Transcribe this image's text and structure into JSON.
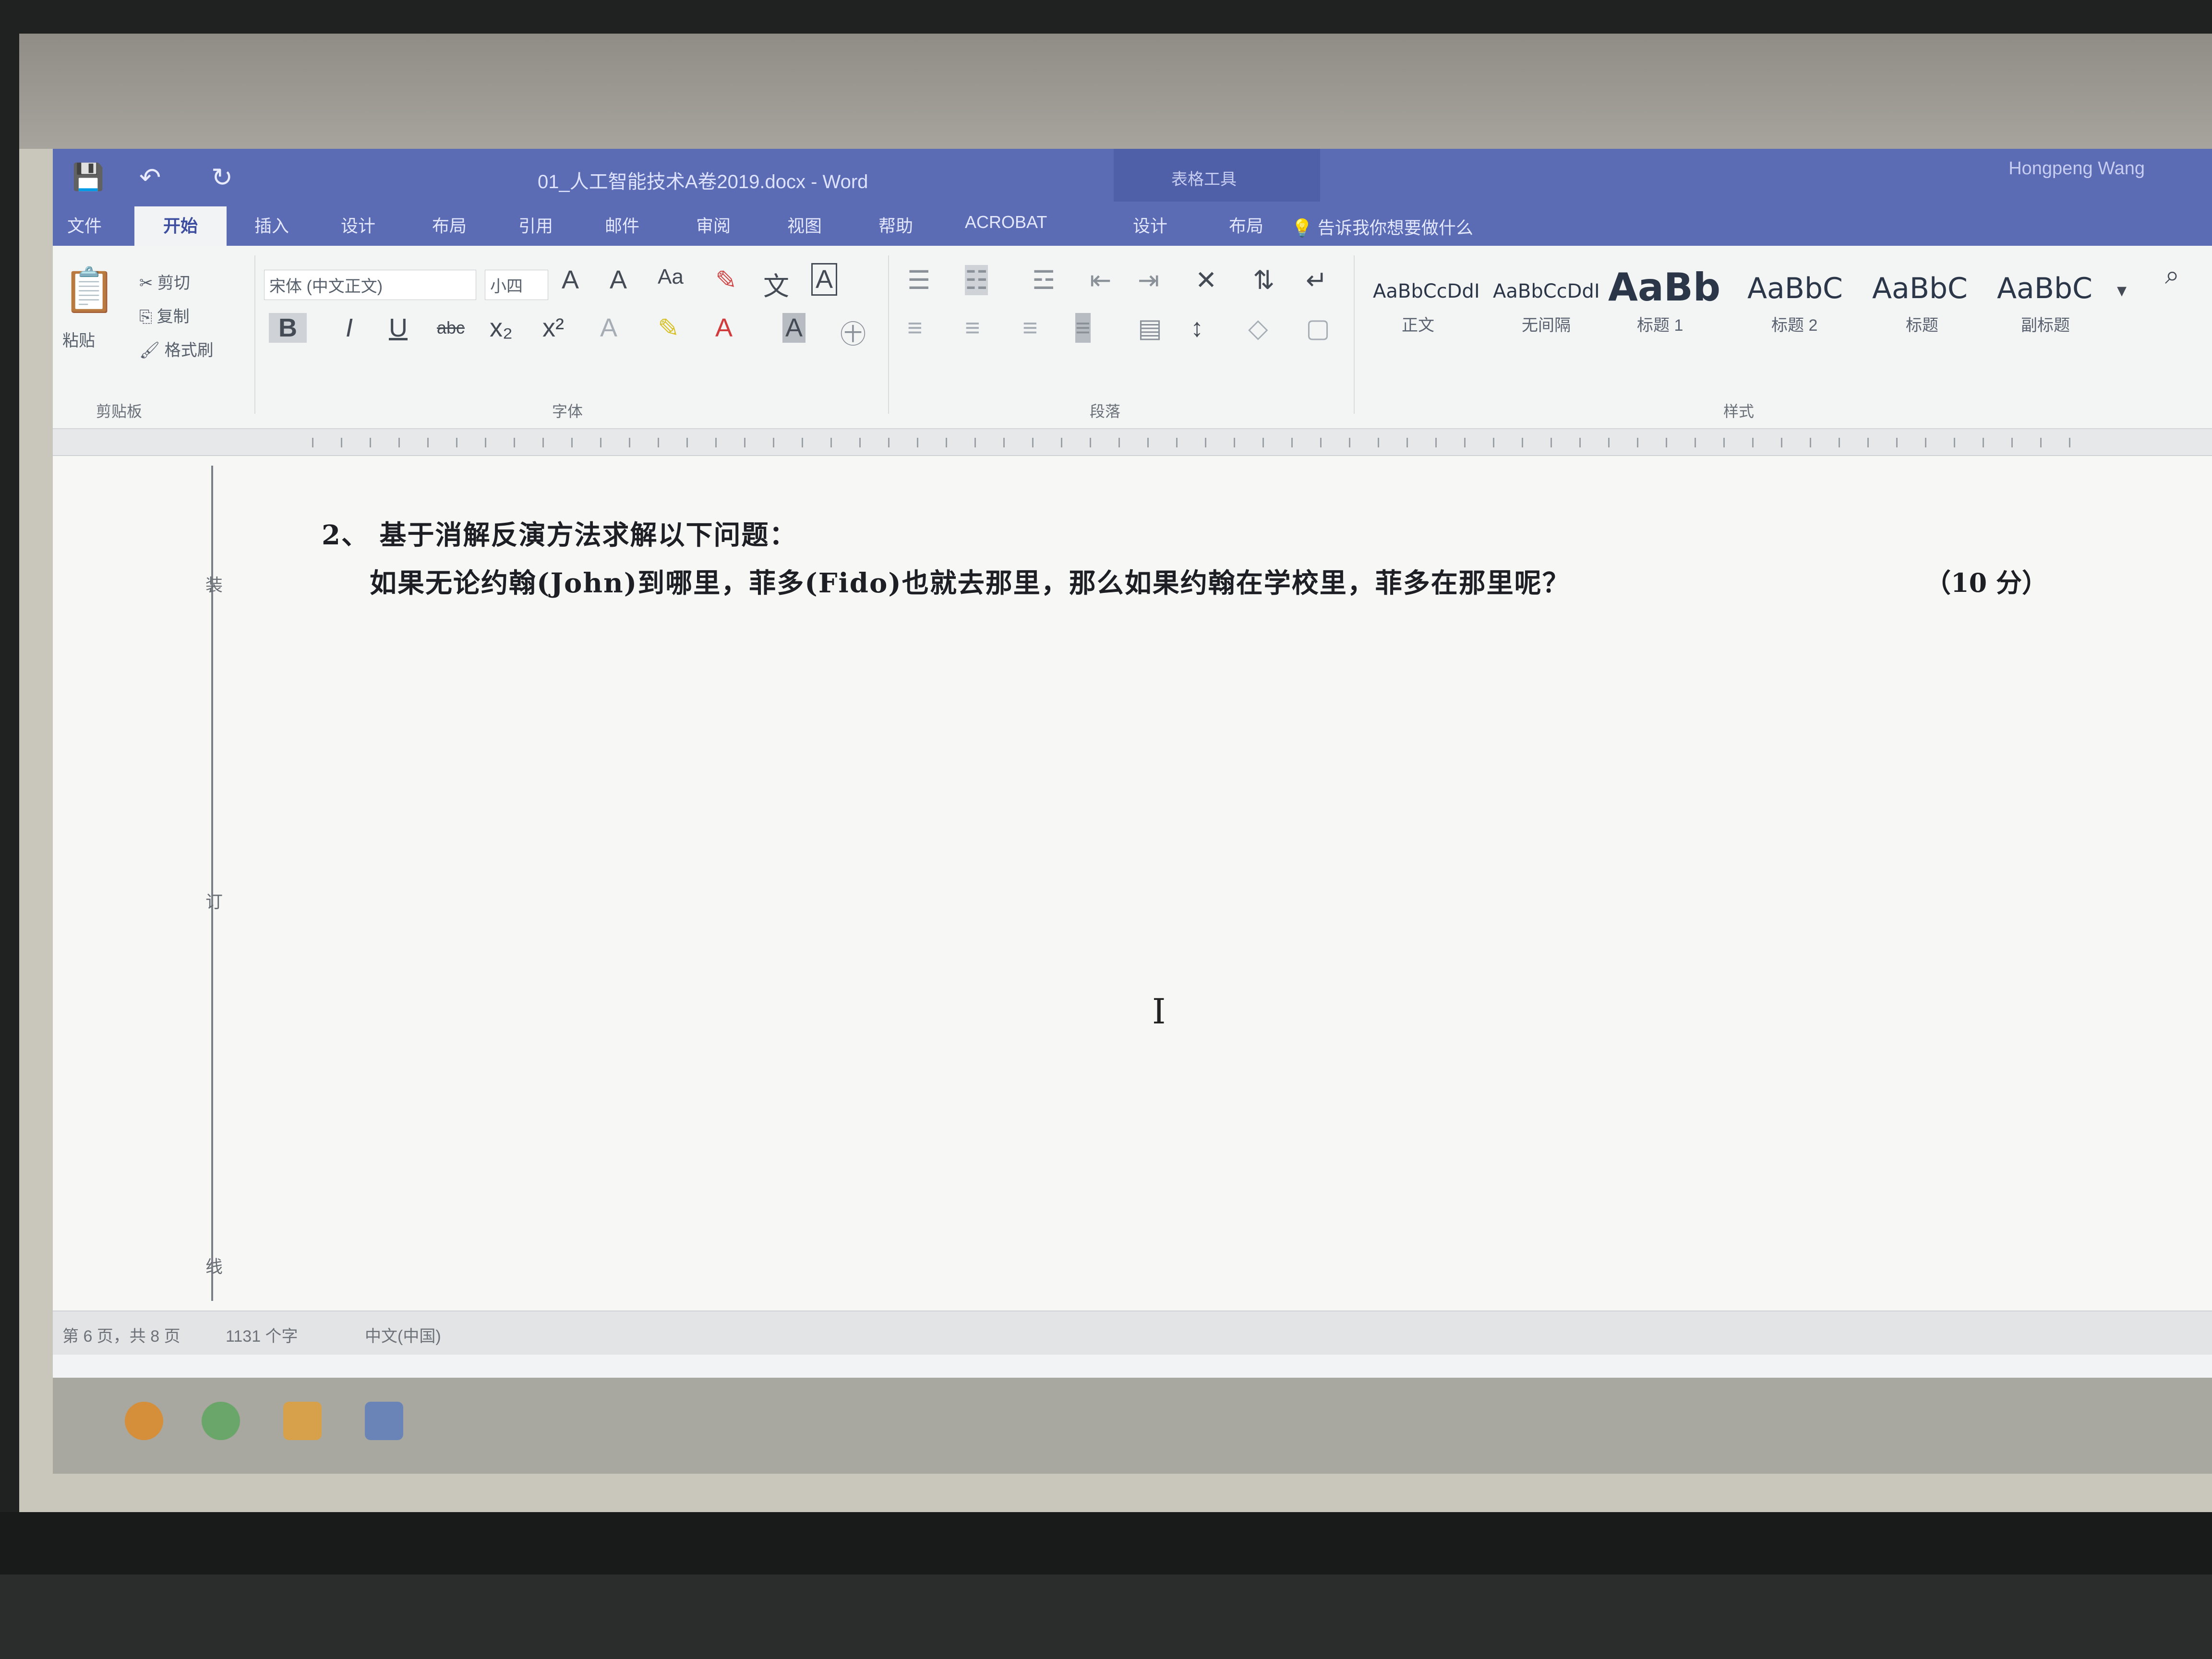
{
  "window": {
    "title": "01_人工智能技术A卷2019.docx - Word",
    "context_tools_label": "表格工具",
    "user": "Hongpeng Wang"
  },
  "tabs": [
    "文件",
    "开始",
    "插入",
    "设计",
    "布局",
    "引用",
    "邮件",
    "审阅",
    "视图",
    "帮助",
    "ACROBAT",
    "设计",
    "布局"
  ],
  "active_tab_index": 1,
  "tell_me": "告诉我你想要做什么",
  "ribbon": {
    "clipboard": {
      "paste": "粘贴",
      "cut": "剪切",
      "copy": "复制",
      "format_painter": "格式刷",
      "label": "剪贴板"
    },
    "font": {
      "font_name": "宋体 (中文正文)",
      "font_size": "小四",
      "label": "字体"
    },
    "paragraph": {
      "label": "段落"
    },
    "styles": {
      "label": "样式",
      "items": [
        {
          "preview": "AaBbCcDdI",
          "name": "正文"
        },
        {
          "preview": "AaBbCcDdI",
          "name": "无间隔"
        },
        {
          "preview": "AaBb",
          "name": "标题 1"
        },
        {
          "preview": "AaBbC",
          "name": "标题 2"
        },
        {
          "preview": "AaBbC",
          "name": "标题"
        },
        {
          "preview": "AaBbC",
          "name": "副标题"
        }
      ]
    }
  },
  "document": {
    "question_title": "2、 基于消解反演方法求解以下问题：",
    "question_body": "如果无论约翰(John)到哪里，菲多(Fido)也就去那里，那么如果约翰在学校里，菲多在那里呢？",
    "score": "（10 分）",
    "margin_marks": [
      "装",
      "订",
      "线"
    ]
  },
  "status": {
    "page": "第 6 页，共 8 页",
    "words": "1131 个字",
    "language": "中文(中国)"
  },
  "icons": [
    "save-icon",
    "undo-icon",
    "redo-icon",
    "search-icon",
    "text-cursor-icon"
  ]
}
